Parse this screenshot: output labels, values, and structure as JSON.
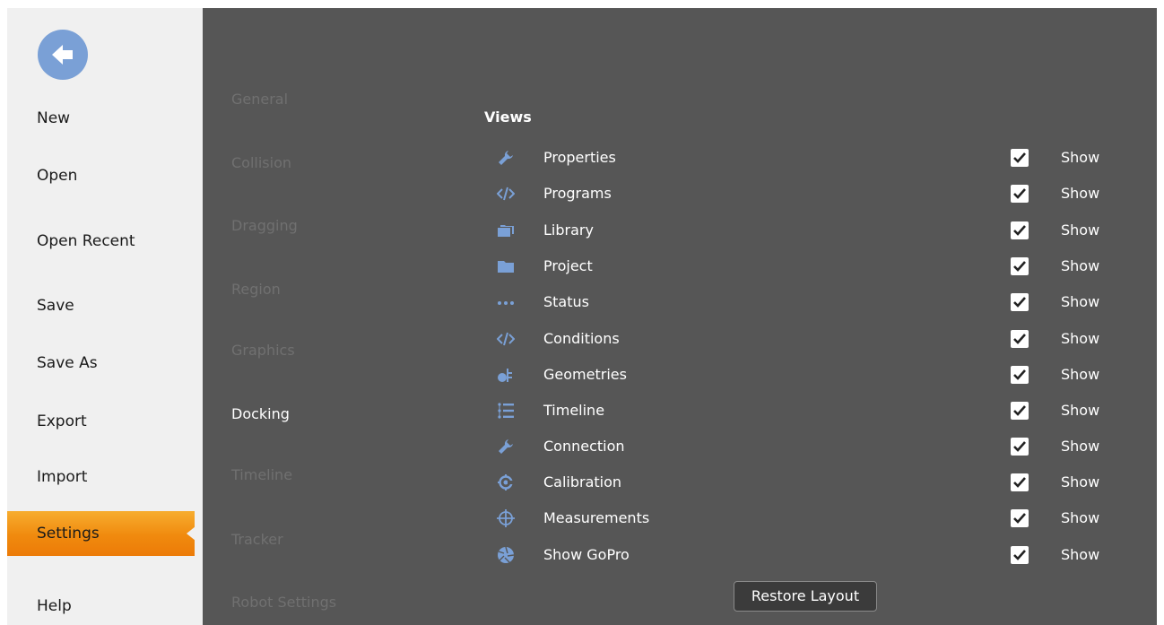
{
  "colors": {
    "sidebar_bg": "#f0f0f0",
    "content_bg": "#565656",
    "accent_orange": "#f08a0e",
    "icon_blue": "#7aa0d6",
    "inactive_category": "#707070"
  },
  "back_button": {
    "icon": "arrow-left-icon"
  },
  "menu": [
    {
      "label": "New",
      "active": false
    },
    {
      "label": "Open",
      "active": false
    },
    {
      "label": "Open Recent",
      "active": false
    },
    {
      "label": "Save",
      "active": false
    },
    {
      "label": "Save As",
      "active": false
    },
    {
      "label": "Export",
      "active": false
    },
    {
      "label": "Import",
      "active": false
    },
    {
      "label": "Settings",
      "active": true
    },
    {
      "label": "Help",
      "active": false
    }
  ],
  "categories": [
    {
      "label": "General",
      "selected": false
    },
    {
      "label": "Collision",
      "selected": false
    },
    {
      "label": "Dragging",
      "selected": false
    },
    {
      "label": "Region",
      "selected": false
    },
    {
      "label": "Graphics",
      "selected": false
    },
    {
      "label": "Docking",
      "selected": true
    },
    {
      "label": "Timeline",
      "selected": false
    },
    {
      "label": "Tracker",
      "selected": false
    },
    {
      "label": "Robot Settings",
      "selected": false
    }
  ],
  "views_heading": "Views",
  "views": [
    {
      "label": "Properties",
      "icon": "wrench-icon",
      "checked": true,
      "show_label": "Show"
    },
    {
      "label": "Programs",
      "icon": "code-icon",
      "checked": true,
      "show_label": "Show"
    },
    {
      "label": "Library",
      "icon": "folders-icon",
      "checked": true,
      "show_label": "Show"
    },
    {
      "label": "Project",
      "icon": "folder-icon",
      "checked": true,
      "show_label": "Show"
    },
    {
      "label": "Status",
      "icon": "dots-icon",
      "checked": true,
      "show_label": "Show"
    },
    {
      "label": "Conditions",
      "icon": "code-icon",
      "checked": true,
      "show_label": "Show"
    },
    {
      "label": "Geometries",
      "icon": "shapes-icon",
      "checked": true,
      "show_label": "Show"
    },
    {
      "label": "Timeline",
      "icon": "list-icon",
      "checked": true,
      "show_label": "Show"
    },
    {
      "label": "Connection",
      "icon": "wrench-icon",
      "checked": true,
      "show_label": "Show"
    },
    {
      "label": "Calibration",
      "icon": "calibration-icon",
      "checked": true,
      "show_label": "Show"
    },
    {
      "label": "Measurements",
      "icon": "crosshair-icon",
      "checked": true,
      "show_label": "Show"
    },
    {
      "label": "Show GoPro",
      "icon": "aperture-icon",
      "checked": true,
      "show_label": "Show"
    }
  ],
  "restore_button": {
    "label": "Restore Layout"
  }
}
